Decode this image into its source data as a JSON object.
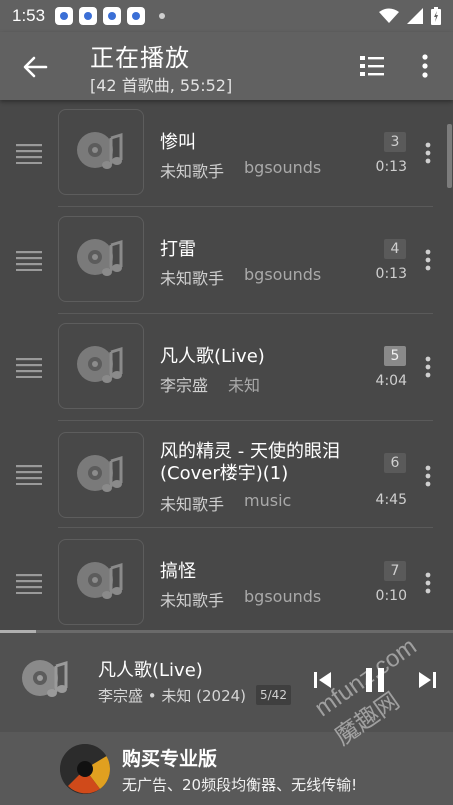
{
  "status_bar": {
    "time": "1:53"
  },
  "header": {
    "title": "正在播放",
    "subtitle": "[42 首歌曲, 55:52]"
  },
  "queue": [
    {
      "title": "惨叫",
      "artist": "未知歌手",
      "album": "bgsounds",
      "track": "3",
      "duration": "0:13",
      "active": false
    },
    {
      "title": "打雷",
      "artist": "未知歌手",
      "album": "bgsounds",
      "track": "4",
      "duration": "0:13",
      "active": false
    },
    {
      "title": "凡人歌(Live)",
      "artist": "李宗盛",
      "album": "未知",
      "track": "5",
      "duration": "4:04",
      "active": true
    },
    {
      "title": "风的精灵 - 天使的眼泪\n(Cover楼宇)(1)",
      "artist": "未知歌手",
      "album": "music",
      "track": "6",
      "duration": "4:45",
      "active": false
    },
    {
      "title": "搞怪",
      "artist": "未知歌手",
      "album": "bgsounds",
      "track": "7",
      "duration": "0:10",
      "active": false
    }
  ],
  "player": {
    "title": "凡人歌(Live)",
    "subtitle": "李宗盛 • 未知 (2024)",
    "position": "5/42",
    "progress_fraction": 0.08
  },
  "ad": {
    "title": "购买专业版",
    "desc": "无广告、20频段均衡器、无线传输!"
  },
  "watermark": "mfunz.com 魔趣网",
  "colors": {
    "background": "#484848",
    "bar": "#616161",
    "player": "#515151"
  }
}
